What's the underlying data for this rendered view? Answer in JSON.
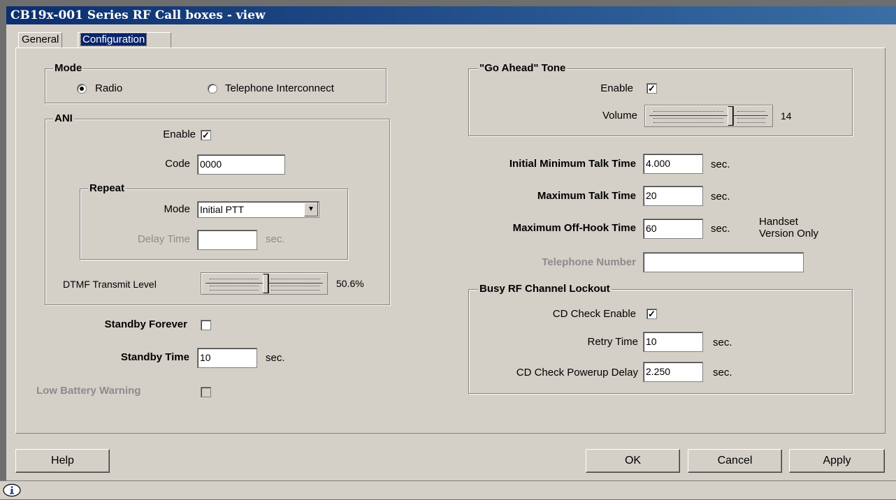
{
  "window": {
    "title": "CB19x-001 Series RF Call boxes - view"
  },
  "tabs": {
    "general": "General",
    "configuration": "Configuration"
  },
  "mode": {
    "group_label": "Mode",
    "radio_label": "Radio",
    "telephone_label": "Telephone Interconnect",
    "selected": "Radio"
  },
  "ani": {
    "group_label": "ANI",
    "enable_label": "Enable",
    "enable_checked": true,
    "code_label": "Code",
    "code_value": "0000",
    "repeat": {
      "group_label": "Repeat",
      "mode_label": "Mode",
      "mode_value": "Initial PTT",
      "delay_label": "Delay Time",
      "delay_value": "",
      "delay_unit": "sec."
    },
    "dtmf_label": "DTMF Transmit Level",
    "dtmf_value": "50.6%",
    "dtmf_level": 0.506
  },
  "standby": {
    "forever_label": "Standby Forever",
    "forever_checked": false,
    "time_label": "Standby Time",
    "time_value": "10",
    "time_unit": "sec.",
    "low_battery_label": "Low Battery Warning",
    "low_battery_checked": false
  },
  "go_ahead": {
    "group_label": "\"Go Ahead\" Tone",
    "enable_label": "Enable",
    "enable_checked": true,
    "volume_label": "Volume",
    "volume_value": "14"
  },
  "talk": {
    "initial_min_label": "Initial Minimum Talk Time",
    "initial_min_value": "4.000",
    "initial_min_unit": "sec.",
    "max_label": "Maximum Talk Time",
    "max_value": "20",
    "max_unit": "sec.",
    "offhook_label": "Maximum Off-Hook Time",
    "offhook_value": "60",
    "offhook_unit": "sec.",
    "handset_note_1": "Handset",
    "handset_note_2": "Version Only",
    "phone_label": "Telephone Number",
    "phone_value": ""
  },
  "busy": {
    "group_label": "Busy RF Channel Lockout",
    "cd_label": "CD Check Enable",
    "cd_checked": true,
    "retry_label": "Retry Time",
    "retry_value": "10",
    "retry_unit": "sec.",
    "powerup_label": "CD Check Powerup Delay",
    "powerup_value": "2.250",
    "powerup_unit": "sec."
  },
  "buttons": {
    "help": "Help",
    "ok": "OK",
    "cancel": "Cancel",
    "apply": "Apply"
  },
  "icons": {
    "status": "info-icon"
  }
}
